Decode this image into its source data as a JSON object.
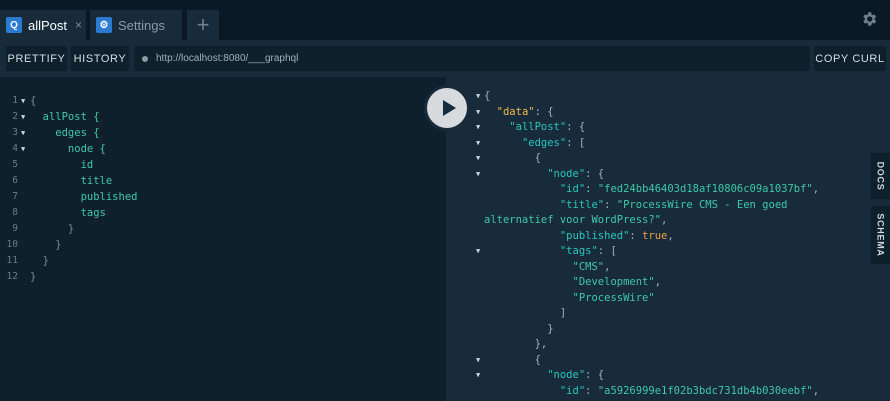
{
  "tabs": [
    {
      "badge": "Q",
      "label": "allPost",
      "close": "×"
    },
    {
      "badge": "⚙",
      "label": "Settings"
    }
  ],
  "add_tab": "+",
  "settings_icon": "gear-icon",
  "toolbar": {
    "prettify": "PRETTIFY",
    "history": "HISTORY",
    "url": "http://localhost:8080/___graphql",
    "copy_curl": "COPY CURL"
  },
  "query_lines": [
    {
      "n": "1",
      "fold": true,
      "text": "{"
    },
    {
      "n": "2",
      "fold": true,
      "text": "  allPost {"
    },
    {
      "n": "3",
      "fold": true,
      "text": "    edges {"
    },
    {
      "n": "4",
      "fold": true,
      "text": "      node {"
    },
    {
      "n": "5",
      "fold": false,
      "text": "        id"
    },
    {
      "n": "6",
      "fold": false,
      "text": "        title"
    },
    {
      "n": "7",
      "fold": false,
      "text": "        published"
    },
    {
      "n": "8",
      "fold": false,
      "text": "        tags"
    },
    {
      "n": "9",
      "fold": false,
      "text": "      }"
    },
    {
      "n": "10",
      "fold": false,
      "text": "    }"
    },
    {
      "n": "11",
      "fold": false,
      "text": "  }"
    },
    {
      "n": "12",
      "fold": false,
      "text": "}"
    }
  ],
  "result_lines": [
    {
      "fold": true,
      "parts": [
        [
          "p",
          "{"
        ]
      ]
    },
    {
      "fold": true,
      "parts": [
        [
          "p",
          "  "
        ],
        [
          "d",
          "\"data\""
        ],
        [
          "p",
          ": {"
        ]
      ]
    },
    {
      "fold": true,
      "parts": [
        [
          "p",
          "    "
        ],
        [
          "k",
          "\"allPost\""
        ],
        [
          "p",
          ": {"
        ]
      ]
    },
    {
      "fold": true,
      "parts": [
        [
          "p",
          "      "
        ],
        [
          "k",
          "\"edges\""
        ],
        [
          "p",
          ": ["
        ]
      ]
    },
    {
      "fold": true,
      "parts": [
        [
          "p",
          "        {"
        ]
      ]
    },
    {
      "fold": true,
      "parts": [
        [
          "p",
          "          "
        ],
        [
          "k",
          "\"node\""
        ],
        [
          "p",
          ": {"
        ]
      ]
    },
    {
      "fold": false,
      "parts": [
        [
          "p",
          "            "
        ],
        [
          "k",
          "\"id\""
        ],
        [
          "p",
          ": "
        ],
        [
          "s",
          "\"fed24bb46403d18af10806c09a1037bf\""
        ],
        [
          "p",
          ","
        ]
      ]
    },
    {
      "fold": false,
      "parts": [
        [
          "p",
          "            "
        ],
        [
          "k",
          "\"title\""
        ],
        [
          "p",
          ": "
        ],
        [
          "s",
          "\"ProcessWire CMS - Een goed"
        ]
      ]
    },
    {
      "fold": false,
      "parts": [
        [
          "s",
          "alternatief voor WordPress?\""
        ],
        [
          "p",
          ","
        ]
      ]
    },
    {
      "fold": false,
      "parts": [
        [
          "p",
          "            "
        ],
        [
          "k",
          "\"published\""
        ],
        [
          "p",
          ": "
        ],
        [
          "b",
          "true"
        ],
        [
          "p",
          ","
        ]
      ]
    },
    {
      "fold": true,
      "parts": [
        [
          "p",
          "            "
        ],
        [
          "k",
          "\"tags\""
        ],
        [
          "p",
          ": ["
        ]
      ]
    },
    {
      "fold": false,
      "parts": [
        [
          "p",
          "              "
        ],
        [
          "s",
          "\"CMS\""
        ],
        [
          "p",
          ","
        ]
      ]
    },
    {
      "fold": false,
      "parts": [
        [
          "p",
          "              "
        ],
        [
          "s",
          "\"Development\""
        ],
        [
          "p",
          ","
        ]
      ]
    },
    {
      "fold": false,
      "parts": [
        [
          "p",
          "              "
        ],
        [
          "s",
          "\"ProcessWire\""
        ]
      ]
    },
    {
      "fold": false,
      "parts": [
        [
          "p",
          "            ]"
        ]
      ]
    },
    {
      "fold": false,
      "parts": [
        [
          "p",
          "          }"
        ]
      ]
    },
    {
      "fold": false,
      "parts": [
        [
          "p",
          "        },"
        ]
      ]
    },
    {
      "fold": true,
      "parts": [
        [
          "p",
          "        {"
        ]
      ]
    },
    {
      "fold": true,
      "parts": [
        [
          "p",
          "          "
        ],
        [
          "k",
          "\"node\""
        ],
        [
          "p",
          ": {"
        ]
      ]
    },
    {
      "fold": false,
      "parts": [
        [
          "p",
          "            "
        ],
        [
          "k",
          "\"id\""
        ],
        [
          "p",
          ": "
        ],
        [
          "s",
          "\"a5926999e1f02b3bdc731db4b030eebf\""
        ],
        [
          "p",
          ","
        ]
      ]
    }
  ],
  "side_tabs": {
    "docs": "DOCS",
    "schema": "SCHEMA"
  },
  "run_icon": "play-icon"
}
